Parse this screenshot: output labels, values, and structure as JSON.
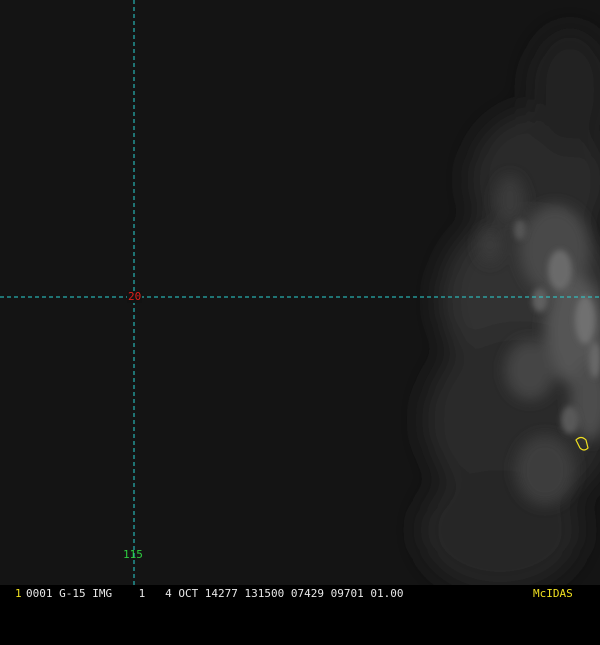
{
  "map": {
    "latitude_label": "20",
    "longitude_label": "115",
    "gridline_color": "#2ad4d4",
    "lat_label_color": "#e0201c",
    "lon_label_color": "#2ecc40",
    "marker_color": "#f0e020"
  },
  "status_bar": {
    "frame_number": "1",
    "product_info": "0001 G-15 IMG    1   4 OCT 14277 131500 07429 09701 01.00",
    "brand": "McIDAS",
    "frame_color": "#f0e020",
    "text_color": "#e8e8e8",
    "brand_color": "#f0e020"
  }
}
